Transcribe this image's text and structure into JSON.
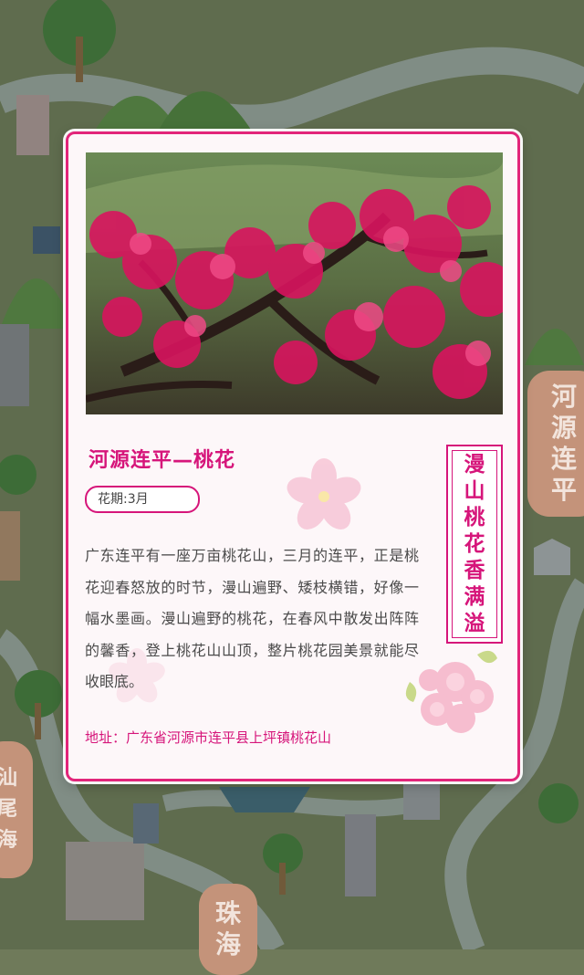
{
  "card": {
    "title": "河源连平—桃花",
    "badge": "花期:3月",
    "description": "广东连平有一座万亩桃花山，三月的连平，正是桃花迎春怒放的时节，漫山遍野、矮枝横错，好像一幅水墨画。漫山遍野的桃花，在春风中散发出阵阵的馨香，登上桃花山山顶，整片桃花园美景就能尽收眼底。",
    "address": "地址：广东省河源市连平县上坪镇桃花山",
    "vertical_slogan": [
      "漫",
      "山",
      "桃",
      "花",
      "香",
      "满",
      "溢"
    ]
  },
  "map_labels": {
    "right_top": [
      "河",
      "源",
      "连",
      "平"
    ],
    "bottom_center": [
      "珠",
      "海"
    ],
    "left_bottom": [
      "汕",
      "尾",
      "海"
    ]
  },
  "colors": {
    "accent": "#d6157a",
    "card_bg": "#fdf7f9",
    "map_bg": "#6f7a5a"
  }
}
